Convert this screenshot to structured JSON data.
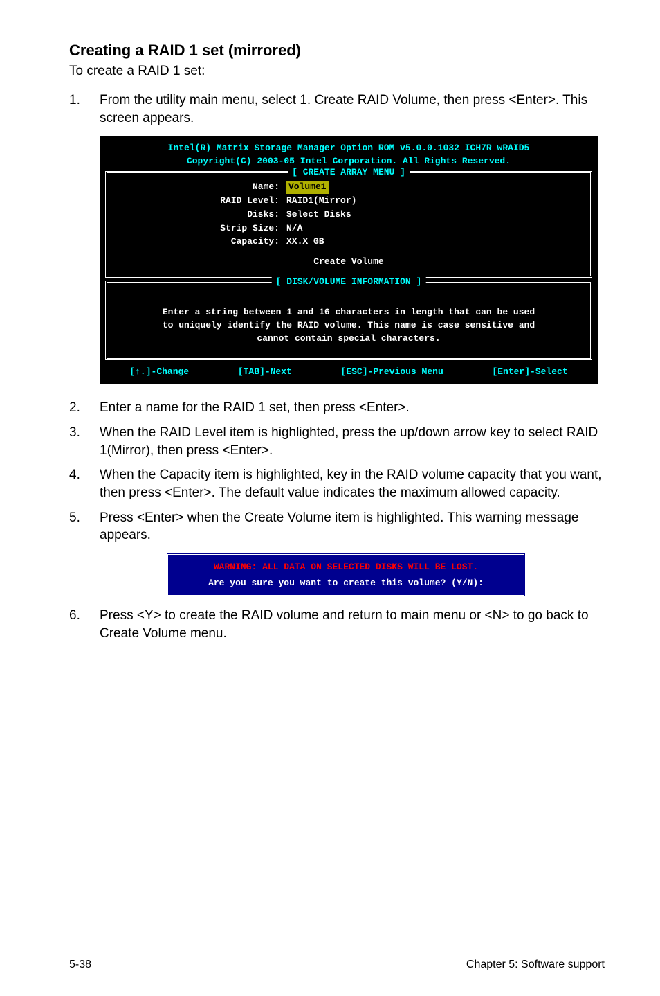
{
  "heading": "Creating a RAID 1 set (mirrored)",
  "intro": "To create a RAID 1 set:",
  "steps": [
    {
      "num": "1.",
      "text": "From the utility main menu, select 1. Create RAID Volume, then press <Enter>. This screen appears."
    },
    {
      "num": "2.",
      "text": "Enter a name for the RAID 1 set, then press <Enter>."
    },
    {
      "num": "3.",
      "text": "When the RAID Level item is highlighted, press the up/down arrow key to select RAID 1(Mirror), then press <Enter>."
    },
    {
      "num": "4.",
      "text": "When the Capacity item is highlighted, key in the RAID volume capacity that you want, then press <Enter>. The default value indicates the maximum allowed capacity."
    },
    {
      "num": "5.",
      "text": "Press <Enter> when the Create Volume item is highlighted. This warning message appears."
    },
    {
      "num": "6.",
      "text": "Press <Y> to create the RAID volume and return to main menu or <N> to go back to Create Volume menu."
    }
  ],
  "console": {
    "header1": "Intel(R) Matrix Storage Manager Option ROM v5.0.0.1032 ICH7R wRAID5",
    "header2": "Copyright(C) 2003-05 Intel Corporation. All Rights Reserved.",
    "create_menu_title": "[ CREATE ARRAY MENU ]",
    "fields": {
      "name_label": "Name:",
      "name_value": "Volume1",
      "level_label": "RAID Level:",
      "level_value": "RAID1(Mirror)",
      "disks_label": "Disks:",
      "disks_value": "Select Disks",
      "strip_label": "Strip Size:",
      "strip_value": "N/A",
      "capacity_label": "Capacity:",
      "capacity_value": "XX.X  GB",
      "create_volume": "Create Volume"
    },
    "diskinfo_title": "[ DISK/VOLUME INFORMATION ]",
    "diskinfo_line1": "Enter a string between 1 and 16 characters in length that can be used",
    "diskinfo_line2": "to uniquely identify the RAID volume. This name is case sensitive and",
    "diskinfo_line3": "cannot contain special characters.",
    "nav": {
      "change": "[↑↓]-Change",
      "tab": "[TAB]-Next",
      "esc": "[ESC]-Previous Menu",
      "enter": "[Enter]-Select"
    }
  },
  "warning": {
    "title": "WARNING: ALL DATA ON SELECTED DISKS WILL BE LOST.",
    "prompt": "Are you sure you want to create this volume? (Y/N):"
  },
  "footer": {
    "left": "5-38",
    "right": "Chapter 5: Software support"
  }
}
